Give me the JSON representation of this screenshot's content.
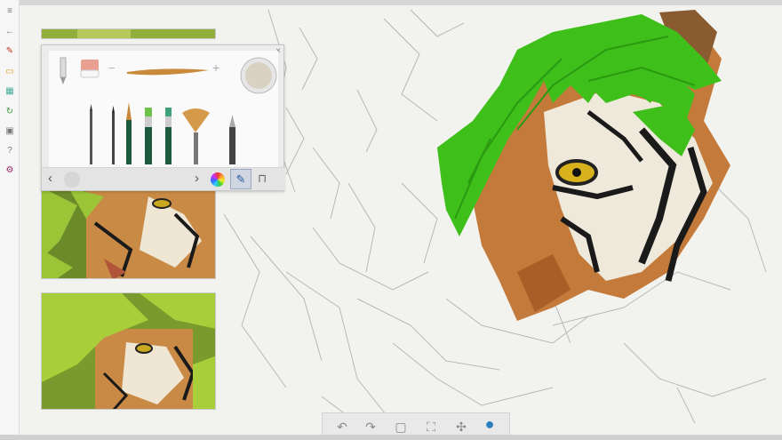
{
  "app": {
    "name": "watercolor tiger painting app"
  },
  "left_toolbar": {
    "items": [
      {
        "name": "menu-icon",
        "glyph": "≡"
      },
      {
        "name": "back-icon",
        "glyph": "←"
      },
      {
        "name": "brush-icon",
        "glyph": "✎"
      },
      {
        "name": "folder-icon",
        "glyph": "▭"
      },
      {
        "name": "gallery-icon",
        "glyph": "▦"
      },
      {
        "name": "refresh-icon",
        "glyph": "↻"
      },
      {
        "name": "save-icon",
        "glyph": "▣"
      },
      {
        "name": "help-icon",
        "glyph": "?"
      },
      {
        "name": "settings-icon",
        "glyph": "⚙"
      }
    ]
  },
  "palette": {
    "close_glyph": "×",
    "size_minus": "−",
    "size_plus": "+",
    "nav_prev": "‹",
    "nav_next": "›",
    "tools": [
      {
        "name": "pencil-tool"
      },
      {
        "name": "eraser-tool"
      },
      {
        "name": "thin-pen-tool"
      },
      {
        "name": "fine-brush-tool"
      },
      {
        "name": "round-brush-tool"
      },
      {
        "name": "flat-brush-tool"
      },
      {
        "name": "angled-brush-tool"
      },
      {
        "name": "fan-brush-tool"
      },
      {
        "name": "graphite-pencil-tool"
      }
    ],
    "active_color": "#d9d2c3"
  },
  "reference_images": [
    {
      "name": "reference-image-1"
    },
    {
      "name": "reference-image-2"
    },
    {
      "name": "reference-image-3"
    }
  ],
  "bottom_dock": {
    "undo": "↶",
    "redo": "↷",
    "layers": "▢",
    "fit": "⛶",
    "fan": "✣",
    "drop": "●"
  },
  "colors": {
    "green": "#3fbf1a",
    "orange": "#c47a3a",
    "dock_active": "#2a7fc1"
  }
}
